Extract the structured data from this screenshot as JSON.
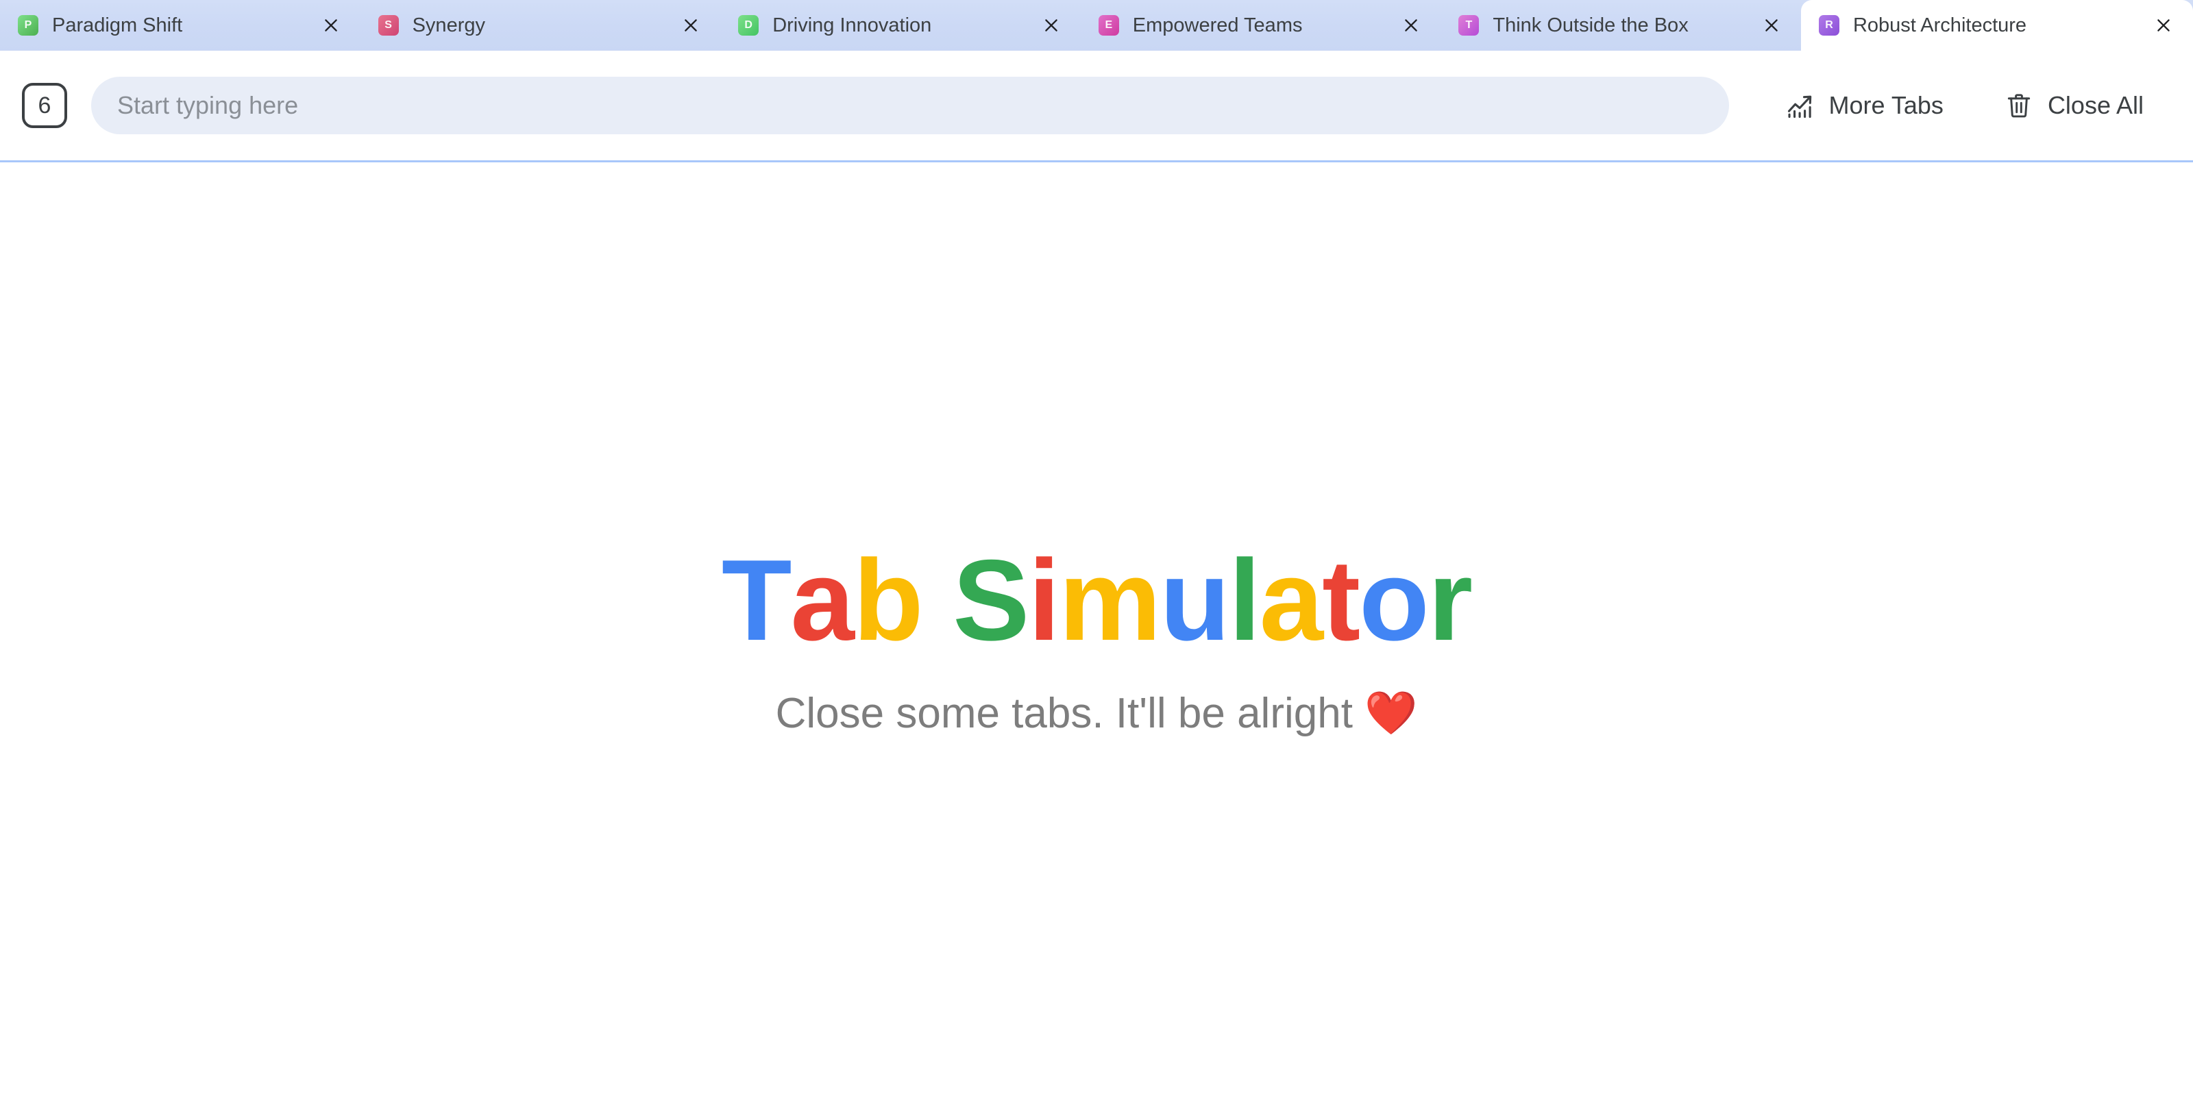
{
  "window": {
    "app_name": "Tab Simulator"
  },
  "tab_strip": {
    "close_icon": "close-icon",
    "tabs": [
      {
        "title": "Paradigm Shift",
        "favicon_letter": "P",
        "favicon_color_start": "#7ee08a",
        "favicon_color_end": "#4caf50",
        "active": false
      },
      {
        "title": "Synergy",
        "favicon_letter": "S",
        "favicon_color_start": "#e8738f",
        "favicon_color_end": "#cf4473",
        "active": false
      },
      {
        "title": "Driving Innovation",
        "favicon_letter": "D",
        "favicon_color_start": "#7ee08a",
        "favicon_color_end": "#43c463",
        "active": false
      },
      {
        "title": "Empowered Teams",
        "favicon_letter": "E",
        "favicon_color_start": "#e171c9",
        "favicon_color_end": "#cf3aa0",
        "active": false
      },
      {
        "title": "Think Outside the Box",
        "favicon_letter": "T",
        "favicon_color_start": "#e07fd6",
        "favicon_color_end": "#b54bd6",
        "active": false
      },
      {
        "title": "Robust Architecture",
        "favicon_letter": "R",
        "favicon_color_start": "#b07ae8",
        "favicon_color_end": "#8b4fd8",
        "active": true
      }
    ]
  },
  "toolbar": {
    "tab_count": "6",
    "search_placeholder": "Start typing here",
    "search_value": "",
    "more_tabs_label": "More Tabs",
    "more_tabs_icon": "trending-up-chart-icon",
    "close_all_label": "Close All",
    "close_all_icon": "trash-icon",
    "border_color": "#a8c7fa"
  },
  "main": {
    "title_text": "Tab Simulator",
    "title_letters": [
      {
        "char": "T",
        "color": "#4285f4"
      },
      {
        "char": "a",
        "color": "#ea4335"
      },
      {
        "char": "b",
        "color": "#fbbc05"
      },
      {
        "char": " ",
        "color": "#ffffff"
      },
      {
        "char": "S",
        "color": "#34a853"
      },
      {
        "char": "i",
        "color": "#ea4335"
      },
      {
        "char": "m",
        "color": "#fbbc05"
      },
      {
        "char": "u",
        "color": "#4285f4"
      },
      {
        "char": "l",
        "color": "#34a853"
      },
      {
        "char": "a",
        "color": "#fbbc05"
      },
      {
        "char": "t",
        "color": "#ea4335"
      },
      {
        "char": "o",
        "color": "#4285f4"
      },
      {
        "char": "r",
        "color": "#34a853"
      }
    ],
    "subtitle": "Close some tabs. It'll be alright ❤️"
  },
  "colors": {
    "tab_strip_background": "#ccd9f5",
    "active_tab_background": "#ffffff",
    "search_background": "#e8edf7",
    "text_primary": "#3c4043",
    "text_muted": "#7d7d7d",
    "google_blue": "#4285f4",
    "google_red": "#ea4335",
    "google_yellow": "#fbbc05",
    "google_green": "#34a853"
  }
}
